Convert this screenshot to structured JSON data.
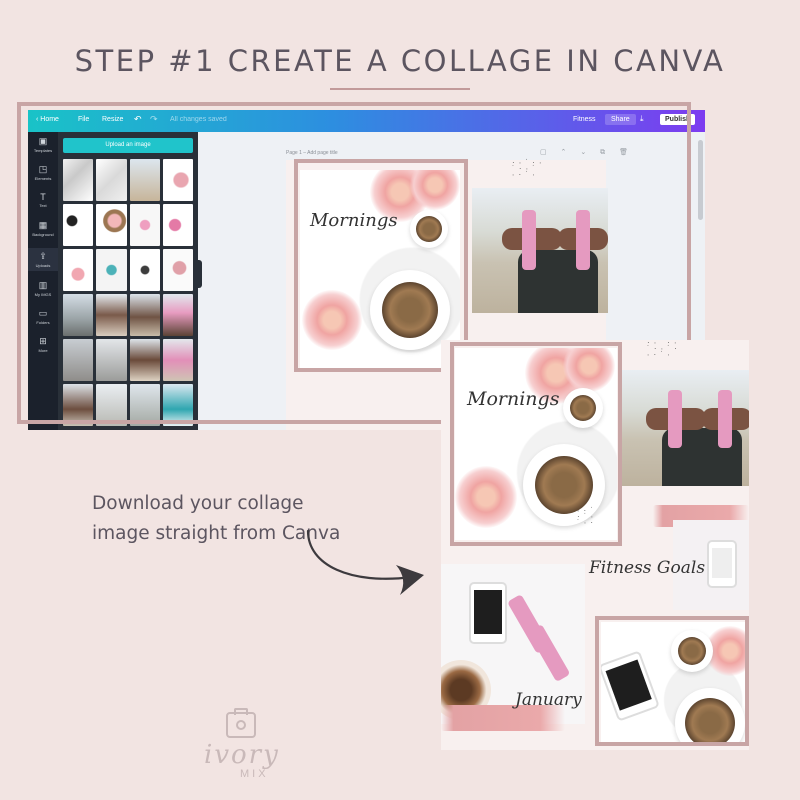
{
  "heading": "STEP #1 CREATE A COLLAGE IN CANVA",
  "caption": "Download your collage image straight from Canva",
  "canva": {
    "topbar": {
      "home": "‹ Home",
      "file": "File",
      "resize": "Resize",
      "undo": "↶",
      "redo": "↷",
      "title": "All changes saved",
      "design_name": "Fitness",
      "share": "Share",
      "download": "⤓",
      "publish": "Publish"
    },
    "sidebar": [
      {
        "icon": "▣",
        "label": "Templates"
      },
      {
        "icon": "◳",
        "label": "Elements"
      },
      {
        "icon": "T",
        "label": "Text"
      },
      {
        "icon": "▦",
        "label": "Background"
      },
      {
        "icon": "⇪",
        "label": "Uploads"
      },
      {
        "icon": "▥",
        "label": "My IMGS"
      },
      {
        "icon": "▭",
        "label": "Folders"
      },
      {
        "icon": "⊞",
        "label": "More"
      }
    ],
    "upload_button": "Upload an image",
    "page_label": "Page 1 – Add page title",
    "page_tools": "▢ ⌃ ⌄ ⧉ 🗑"
  },
  "collage": {
    "script_mornings": "Mornings",
    "script_fitness": "Fitness Goals",
    "script_january": "January"
  },
  "logo": {
    "script": "ivory",
    "word": "MIX"
  },
  "colors": {
    "background": "#f2e4e2",
    "accent_frame": "#c8a5a5",
    "heading_text": "#5c5560",
    "canva_teal": "#19c3c7",
    "canva_purple": "#7d3cf0"
  }
}
